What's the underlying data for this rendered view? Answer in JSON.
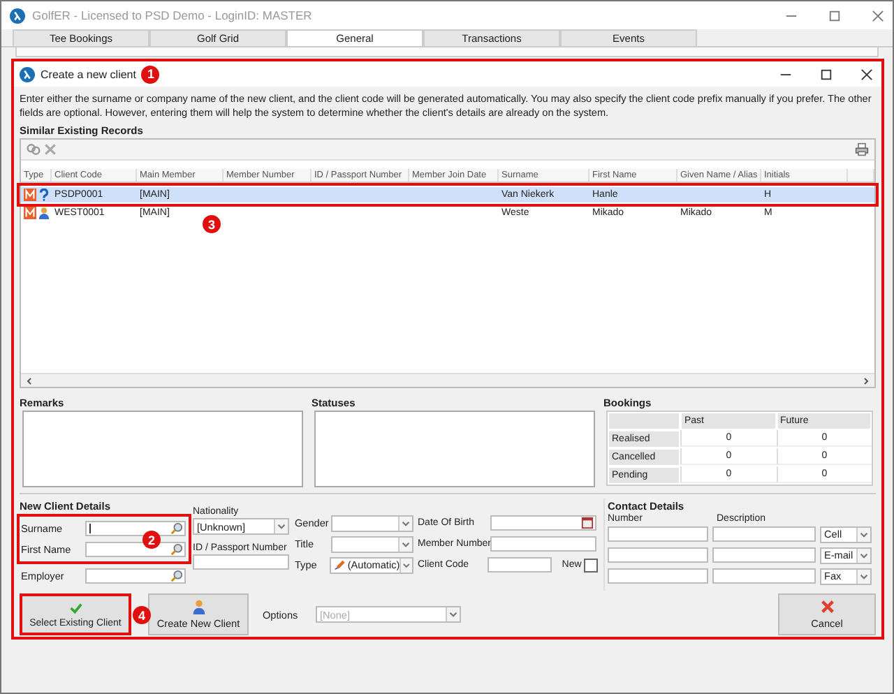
{
  "window": {
    "title": "GolfER - Licensed to PSD Demo - LoginID: MASTER"
  },
  "tabs": [
    {
      "label": "Tee Bookings",
      "selected": false
    },
    {
      "label": "Golf Grid",
      "selected": false
    },
    {
      "label": "General",
      "selected": true
    },
    {
      "label": "Transactions",
      "selected": false
    },
    {
      "label": "Events",
      "selected": false
    }
  ],
  "dialog": {
    "title": "Create a new client",
    "intro": "Enter either the surname or company name of the new client, and the client code will be generated automatically. You may also specify the client code prefix manually if you prefer. The other fields are optional. However, entering them will help the system to determine whether the client's details are already on the system.",
    "similar_heading": "Similar Existing Records",
    "table": {
      "columns": [
        "Type",
        "Client Code",
        "Main Member",
        "Member Number",
        "ID / Passport Number",
        "Member Join Date",
        "Surname",
        "First Name",
        "Given Name / Alias",
        "Initials"
      ],
      "rows": [
        {
          "kind": "unknown",
          "selected": true,
          "cells": [
            "",
            "PSDP0001",
            "[MAIN]",
            "",
            "",
            "",
            "Van Niekerk",
            "Hanle",
            "",
            "H"
          ]
        },
        {
          "kind": "person",
          "selected": false,
          "cells": [
            "",
            "WEST0001",
            "[MAIN]",
            "",
            "",
            "",
            "Weste",
            "Mikado",
            "Mikado",
            "M"
          ]
        }
      ]
    },
    "remarks_label": "Remarks",
    "statuses_label": "Statuses",
    "bookings": {
      "label": "Bookings",
      "columns": [
        "Past",
        "Future"
      ],
      "rows": [
        {
          "label": "Realised",
          "past": "0",
          "future": "0"
        },
        {
          "label": "Cancelled",
          "past": "0",
          "future": "0"
        },
        {
          "label": "Pending",
          "past": "0",
          "future": "0"
        }
      ]
    },
    "new_client": {
      "heading": "New Client Details",
      "surname_label": "Surname",
      "first_name_label": "First Name",
      "employer_label": "Employer",
      "nationality_label": "Nationality",
      "nationality_value": "[Unknown]",
      "id_label": "ID / Passport Number",
      "gender_label": "Gender",
      "title_label": "Title",
      "type_label": "Type",
      "type_value": "(Automatic)",
      "dob_label": "Date Of Birth",
      "member_number_label": "Member Number",
      "client_code_label": "Client Code",
      "new_label": "New",
      "new_checked": false
    },
    "contact": {
      "heading": "Contact Details",
      "number_label": "Number",
      "description_label": "Description",
      "rows": [
        {
          "type": "Cell"
        },
        {
          "type": "E-mail"
        },
        {
          "type": "Fax"
        }
      ]
    },
    "buttons": {
      "select": "Select Existing Client",
      "create": "Create New Client",
      "cancel": "Cancel"
    },
    "options": {
      "label": "Options",
      "value": "[None]",
      "disabled": true
    }
  },
  "annotations": [
    {
      "label": "1"
    },
    {
      "label": "2"
    },
    {
      "label": "3"
    },
    {
      "label": "4"
    }
  ]
}
